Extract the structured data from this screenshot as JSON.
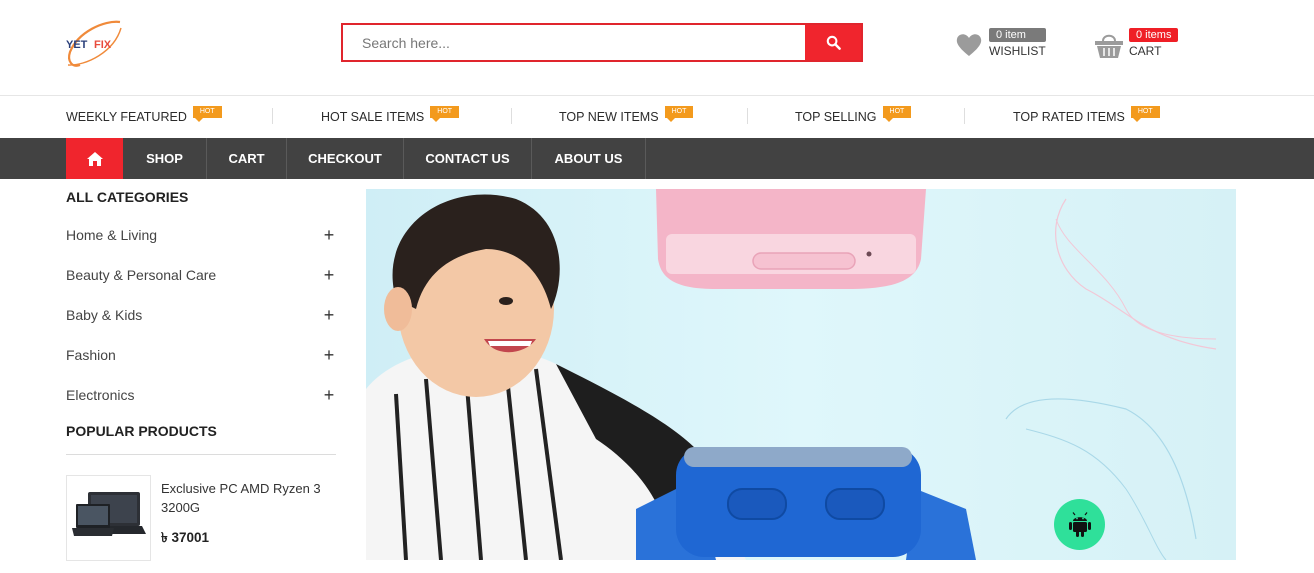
{
  "brand": {
    "name": "YET FIX",
    "colors": {
      "accent": "#f0252d",
      "nav_bg": "#424242",
      "hot_tag": "#f39a1d",
      "badge_grey": "#7a7a7a"
    }
  },
  "search": {
    "placeholder": "Search here...",
    "button_icon": "search-icon"
  },
  "wishlist": {
    "count": "0 item",
    "label": "WISHLIST",
    "icon": "heart-icon"
  },
  "cart": {
    "count": "0 items",
    "label": "CART",
    "icon": "basket-icon"
  },
  "hot_links": [
    {
      "label": "WEEKLY FEATURED",
      "tag": "HOT"
    },
    {
      "label": "HOT SALE ITEMS",
      "tag": "HOT"
    },
    {
      "label": "TOP NEW ITEMS",
      "tag": "HOT"
    },
    {
      "label": "TOP SELLING",
      "tag": "HOT"
    },
    {
      "label": "TOP RATED ITEMS",
      "tag": "HOT"
    }
  ],
  "nav": {
    "home_icon": "home-icon",
    "items": [
      "SHOP",
      "CART",
      "CHECKOUT",
      "CONTACT US",
      "ABOUT US"
    ]
  },
  "sidebar": {
    "categories_title": "ALL CATEGORIES",
    "categories": [
      "Home & Living",
      "Beauty & Personal Care",
      "Baby & Kids",
      "Fashion",
      "Electronics"
    ],
    "expand_symbol": "+",
    "popular_title": "POPULAR PRODUCTS",
    "products": [
      {
        "name": "Exclusive PC AMD Ryzen 3 3200G",
        "price": "৳ 37001"
      }
    ]
  },
  "banner": {
    "android_icon": "android-icon"
  }
}
